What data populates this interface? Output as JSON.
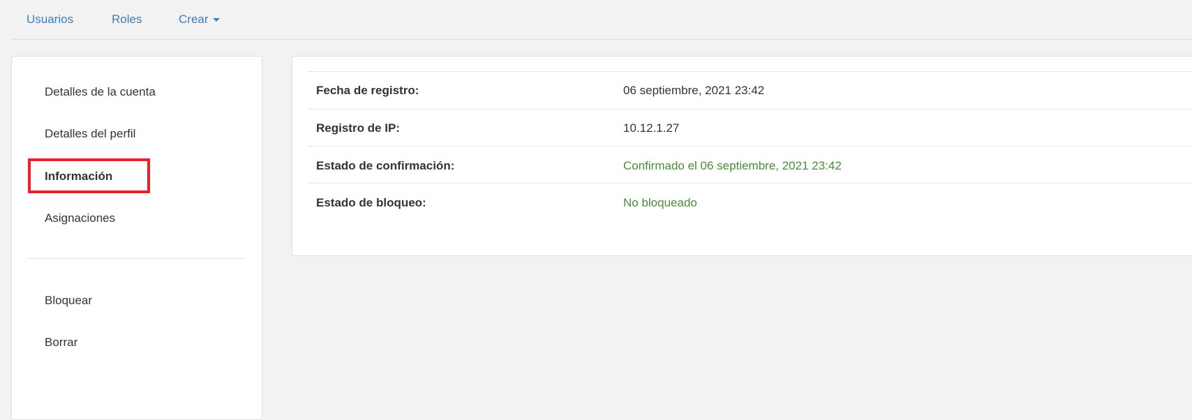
{
  "nav": {
    "users": "Usuarios",
    "roles": "Roles",
    "create": "Crear"
  },
  "sidebar": {
    "items": [
      {
        "label": "Detalles de la cuenta"
      },
      {
        "label": "Detalles del perfil"
      },
      {
        "label": "Información",
        "active": true
      },
      {
        "label": "Asignaciones"
      }
    ],
    "actions": [
      {
        "label": "Bloquear"
      },
      {
        "label": "Borrar"
      }
    ]
  },
  "info": {
    "rows": [
      {
        "label": "Fecha de registro:",
        "value": "06 septiembre, 2021 23:42"
      },
      {
        "label": "Registro de IP:",
        "value": "10.12.1.27"
      },
      {
        "label": "Estado de confirmación:",
        "value": "Confirmado el 06 septiembre, 2021 23:42"
      },
      {
        "label": "Estado de bloqueo:",
        "value": "No bloqueado"
      }
    ]
  },
  "colors": {
    "link": "#3c7eb9",
    "success": "#4a8a3a",
    "highlight": "#e8212a"
  }
}
